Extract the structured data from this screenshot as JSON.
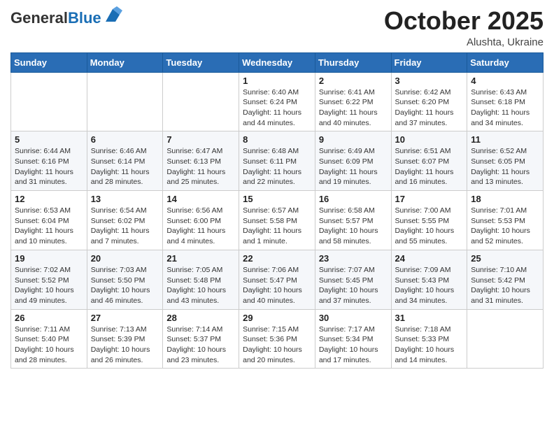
{
  "header": {
    "logo_general": "General",
    "logo_blue": "Blue",
    "month": "October 2025",
    "location": "Alushta, Ukraine"
  },
  "weekdays": [
    "Sunday",
    "Monday",
    "Tuesday",
    "Wednesday",
    "Thursday",
    "Friday",
    "Saturday"
  ],
  "weeks": [
    [
      {
        "day": "",
        "info": ""
      },
      {
        "day": "",
        "info": ""
      },
      {
        "day": "",
        "info": ""
      },
      {
        "day": "1",
        "info": "Sunrise: 6:40 AM\nSunset: 6:24 PM\nDaylight: 11 hours\nand 44 minutes."
      },
      {
        "day": "2",
        "info": "Sunrise: 6:41 AM\nSunset: 6:22 PM\nDaylight: 11 hours\nand 40 minutes."
      },
      {
        "day": "3",
        "info": "Sunrise: 6:42 AM\nSunset: 6:20 PM\nDaylight: 11 hours\nand 37 minutes."
      },
      {
        "day": "4",
        "info": "Sunrise: 6:43 AM\nSunset: 6:18 PM\nDaylight: 11 hours\nand 34 minutes."
      }
    ],
    [
      {
        "day": "5",
        "info": "Sunrise: 6:44 AM\nSunset: 6:16 PM\nDaylight: 11 hours\nand 31 minutes."
      },
      {
        "day": "6",
        "info": "Sunrise: 6:46 AM\nSunset: 6:14 PM\nDaylight: 11 hours\nand 28 minutes."
      },
      {
        "day": "7",
        "info": "Sunrise: 6:47 AM\nSunset: 6:13 PM\nDaylight: 11 hours\nand 25 minutes."
      },
      {
        "day": "8",
        "info": "Sunrise: 6:48 AM\nSunset: 6:11 PM\nDaylight: 11 hours\nand 22 minutes."
      },
      {
        "day": "9",
        "info": "Sunrise: 6:49 AM\nSunset: 6:09 PM\nDaylight: 11 hours\nand 19 minutes."
      },
      {
        "day": "10",
        "info": "Sunrise: 6:51 AM\nSunset: 6:07 PM\nDaylight: 11 hours\nand 16 minutes."
      },
      {
        "day": "11",
        "info": "Sunrise: 6:52 AM\nSunset: 6:05 PM\nDaylight: 11 hours\nand 13 minutes."
      }
    ],
    [
      {
        "day": "12",
        "info": "Sunrise: 6:53 AM\nSunset: 6:04 PM\nDaylight: 11 hours\nand 10 minutes."
      },
      {
        "day": "13",
        "info": "Sunrise: 6:54 AM\nSunset: 6:02 PM\nDaylight: 11 hours\nand 7 minutes."
      },
      {
        "day": "14",
        "info": "Sunrise: 6:56 AM\nSunset: 6:00 PM\nDaylight: 11 hours\nand 4 minutes."
      },
      {
        "day": "15",
        "info": "Sunrise: 6:57 AM\nSunset: 5:58 PM\nDaylight: 11 hours\nand 1 minute."
      },
      {
        "day": "16",
        "info": "Sunrise: 6:58 AM\nSunset: 5:57 PM\nDaylight: 10 hours\nand 58 minutes."
      },
      {
        "day": "17",
        "info": "Sunrise: 7:00 AM\nSunset: 5:55 PM\nDaylight: 10 hours\nand 55 minutes."
      },
      {
        "day": "18",
        "info": "Sunrise: 7:01 AM\nSunset: 5:53 PM\nDaylight: 10 hours\nand 52 minutes."
      }
    ],
    [
      {
        "day": "19",
        "info": "Sunrise: 7:02 AM\nSunset: 5:52 PM\nDaylight: 10 hours\nand 49 minutes."
      },
      {
        "day": "20",
        "info": "Sunrise: 7:03 AM\nSunset: 5:50 PM\nDaylight: 10 hours\nand 46 minutes."
      },
      {
        "day": "21",
        "info": "Sunrise: 7:05 AM\nSunset: 5:48 PM\nDaylight: 10 hours\nand 43 minutes."
      },
      {
        "day": "22",
        "info": "Sunrise: 7:06 AM\nSunset: 5:47 PM\nDaylight: 10 hours\nand 40 minutes."
      },
      {
        "day": "23",
        "info": "Sunrise: 7:07 AM\nSunset: 5:45 PM\nDaylight: 10 hours\nand 37 minutes."
      },
      {
        "day": "24",
        "info": "Sunrise: 7:09 AM\nSunset: 5:43 PM\nDaylight: 10 hours\nand 34 minutes."
      },
      {
        "day": "25",
        "info": "Sunrise: 7:10 AM\nSunset: 5:42 PM\nDaylight: 10 hours\nand 31 minutes."
      }
    ],
    [
      {
        "day": "26",
        "info": "Sunrise: 7:11 AM\nSunset: 5:40 PM\nDaylight: 10 hours\nand 28 minutes."
      },
      {
        "day": "27",
        "info": "Sunrise: 7:13 AM\nSunset: 5:39 PM\nDaylight: 10 hours\nand 26 minutes."
      },
      {
        "day": "28",
        "info": "Sunrise: 7:14 AM\nSunset: 5:37 PM\nDaylight: 10 hours\nand 23 minutes."
      },
      {
        "day": "29",
        "info": "Sunrise: 7:15 AM\nSunset: 5:36 PM\nDaylight: 10 hours\nand 20 minutes."
      },
      {
        "day": "30",
        "info": "Sunrise: 7:17 AM\nSunset: 5:34 PM\nDaylight: 10 hours\nand 17 minutes."
      },
      {
        "day": "31",
        "info": "Sunrise: 7:18 AM\nSunset: 5:33 PM\nDaylight: 10 hours\nand 14 minutes."
      },
      {
        "day": "",
        "info": ""
      }
    ]
  ]
}
